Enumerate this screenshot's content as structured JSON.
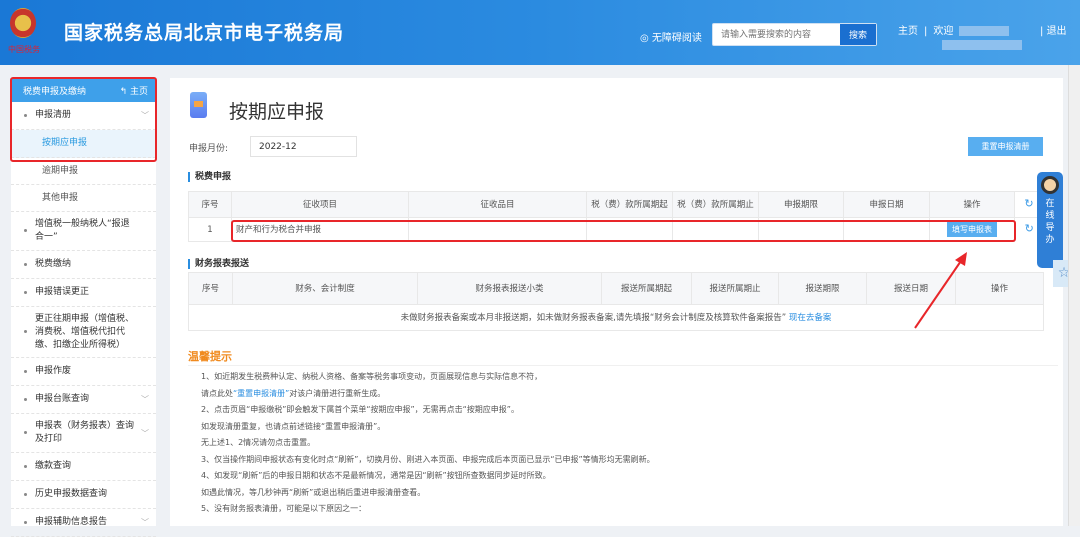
{
  "header": {
    "title": "国家税务总局北京市电子税务局",
    "emblem_text": "中国税务",
    "accessibility": "无障碍阅读",
    "search_placeholder": "请输入需要搜索的内容",
    "search_btn": "搜索",
    "home": "主页",
    "welcome": "欢迎",
    "logout": "退出"
  },
  "sidebar": {
    "title": "税费申报及缴纳",
    "home": "主页",
    "items": [
      {
        "label": "申报清册",
        "type": "group",
        "chevron": true
      },
      {
        "label": "按期应申报",
        "type": "sub",
        "active": true
      },
      {
        "label": "逾期申报",
        "type": "sub"
      },
      {
        "label": "其他申报",
        "type": "sub"
      },
      {
        "label": "增值税一般纳税人“报退合一”",
        "type": "group"
      },
      {
        "label": "税费缴纳",
        "type": "group"
      },
      {
        "label": "申报错误更正",
        "type": "group"
      },
      {
        "label": "更正往期申报（增值税、消费税、增值税代扣代缴、扣缴企业所得税）",
        "type": "group"
      },
      {
        "label": "申报作废",
        "type": "group"
      },
      {
        "label": "申报台账查询",
        "type": "group",
        "chevron": true
      },
      {
        "label": "申报表（财务报表）查询及打印",
        "type": "group",
        "chevron": true
      },
      {
        "label": "缴款查询",
        "type": "group"
      },
      {
        "label": "历史申报数据查询",
        "type": "group"
      },
      {
        "label": "申报辅助信息报告",
        "type": "group",
        "chevron": true
      }
    ]
  },
  "main": {
    "title": "按期应申报",
    "month_label": "申报月份:",
    "month_value": "2022-12",
    "reset_btn": "重置申报清册",
    "tax_section": "税费申报",
    "tax_headers": [
      "序号",
      "征收项目",
      "征收品目",
      "税（费）款所属期起",
      "税（费）款所属期止",
      "申报期限",
      "申报日期",
      "操作"
    ],
    "tax_rows": [
      {
        "no": "1",
        "item": "财产和行为税合并申报",
        "action": "填写申报表"
      }
    ],
    "fin_section": "财务报表报送",
    "fin_headers": [
      "序号",
      "财务、会计制度",
      "财务报表报送小类",
      "报送所属期起",
      "报送所属期止",
      "报送期限",
      "报送日期",
      "操作"
    ],
    "fin_empty": "未做财务报表备案或本月非报送期，如未做财务报表备案,请先填报“财务会计制度及核算软件备案报告”",
    "fin_link": "现在去备案",
    "tips_title": "温馨提示",
    "tips": [
      "1、如近期发生税费种认定、纳税人资格、备案等税务事项变动，页面展现信息与实际信息不符，",
      "请点此处",
      "“重置申报清册”",
      "对该户清册进行重新生成。",
      "2、点击页眉“申报缴税”即会触发下属首个菜单“按期应申报”，无需再点击“按期应申报”。",
      "如发现清册重复，也请点前述链接“重置申报清册”。",
      "无上述1、2情况请勿点击重置。",
      "3、仅当操作期间申报状态有变化时点“刷新”，切换月份、刚进入本页面、申报完成后本页面已显示“已申报”等情形均无需刷新。",
      "4、如发现“刷新”后的申报日期和状态不是最新情况，通常是因“刷新”按钮所查数据同步延时所致。",
      "如遇此情况，等几秒钟再“刷新”或退出稍后重进申报清册查看。",
      "5、没有财务报表清册，可能是以下原因之一："
    ]
  },
  "float": {
    "label": "在线导办"
  }
}
